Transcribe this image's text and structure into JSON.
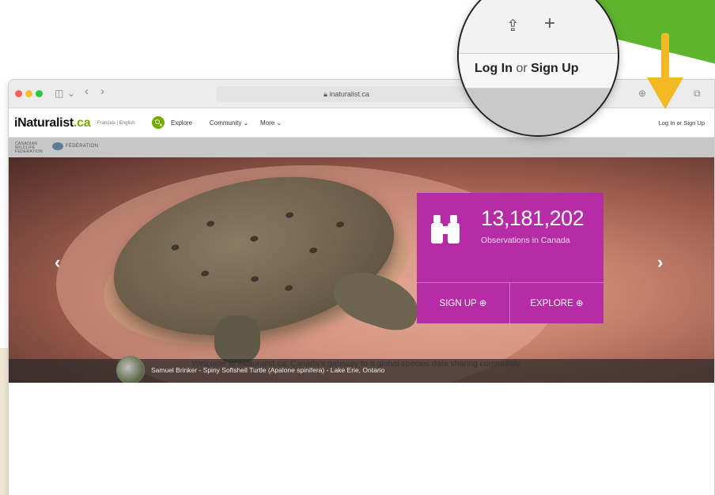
{
  "browser": {
    "url": "inaturalist.ca",
    "nav_back": "‹",
    "nav_forward": "›",
    "sidebar_icon": "◫",
    "chevron_icon": "⌄",
    "tabs_icon": "⧉",
    "download_icon": "⊕",
    "traffic_lights": {
      "close": "#fe5f57",
      "minimize": "#febc2e",
      "maximize": "#28c840"
    }
  },
  "site": {
    "brand_main": "iNaturalist",
    "brand_suffix": ".ca",
    "languages": "Français | English",
    "nav": {
      "explore": "Explore",
      "community": "Community ⌄",
      "more": "More ⌄"
    },
    "login_link": "Log In",
    "login_or": "or",
    "signup_link": "Sign Up",
    "federation_left": "CANADIAN WILDLIFE FEDERATION",
    "federation_right": "FÉDÉRATION"
  },
  "hero": {
    "stat_number": "13,181,202",
    "stat_label": "Observations in Canada",
    "signup_button": "SIGN UP ⊕",
    "explore_button": "EXPLORE ⊕",
    "prev_arrow": "‹",
    "next_arrow": "›",
    "caption": "Samuel Brinker  -  Spiny Softshell Turtle (Apalone spinifera) - Lake Erie, Ontario",
    "accent_color": "#b52ca6"
  },
  "welcome": "Welcome to iNaturalist.ca, Canada's gateway to a global species data sharing community",
  "magnifier": {
    "share_icon": "⇪",
    "plus_icon": "+",
    "login_text": "Log In",
    "or_text": "or",
    "signup_text": "Sign Up"
  },
  "colors": {
    "brand_green": "#74ac00",
    "arrow_yellow": "#f2b925",
    "corner_green": "#5fb42e"
  }
}
